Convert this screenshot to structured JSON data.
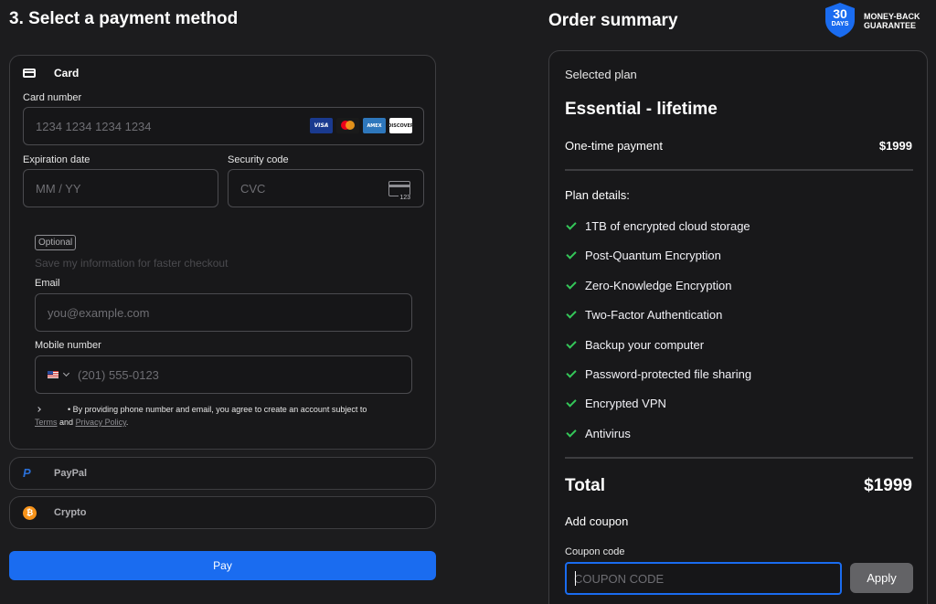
{
  "payment": {
    "title": "3. Select a payment method",
    "card": {
      "label": "Card",
      "number_label": "Card number",
      "number_placeholder": "1234 1234 1234 1234",
      "brands": [
        "VISA",
        "mastercard",
        "AMEX",
        "DISCOVER"
      ],
      "expiry_label": "Expiration date",
      "expiry_placeholder": "MM / YY",
      "cvc_label": "Security code",
      "cvc_placeholder": "CVC",
      "cvc_icon_text": "123"
    },
    "optional_badge": "Optional",
    "save_info": "Save my information for faster checkout",
    "email_label": "Email",
    "email_placeholder": "you@example.com",
    "mobile_label": "Mobile number",
    "mobile_placeholder": "(201) 555-0123",
    "consent_text": "• By providing phone number and email, you agree to create an account subject to",
    "terms_link": "Terms",
    "and_text": "and",
    "privacy_link": "Privacy Policy",
    "period": ".",
    "paypal_label": "PayPal",
    "crypto_label": "Crypto",
    "pay_button": "Pay"
  },
  "summary": {
    "title": "Order summary",
    "badge_days_number": "30",
    "badge_days_label": "DAYS",
    "badge_line1": "MONEY-BACK",
    "badge_line2": "GUARANTEE",
    "selected_plan_label": "Selected plan",
    "plan_name": "Essential - lifetime",
    "payment_type": "One-time payment",
    "payment_price": "$1999",
    "plan_details_label": "Plan details:",
    "features": [
      "1TB of encrypted cloud storage",
      "Post-Quantum Encryption",
      "Zero-Knowledge Encryption",
      "Two-Factor Authentication",
      "Backup your computer",
      "Password-protected file sharing",
      "Encrypted VPN",
      "Antivirus"
    ],
    "total_label": "Total",
    "total_price": "$1999",
    "add_coupon": "Add coupon",
    "coupon_label": "Coupon code",
    "coupon_placeholder": "COUPON CODE",
    "apply_button": "Apply"
  },
  "colors": {
    "background": "#1c1c1e",
    "accent_blue": "#1a6cf0",
    "check_green": "#34c759",
    "badge_blue": "#1a6cf0"
  }
}
